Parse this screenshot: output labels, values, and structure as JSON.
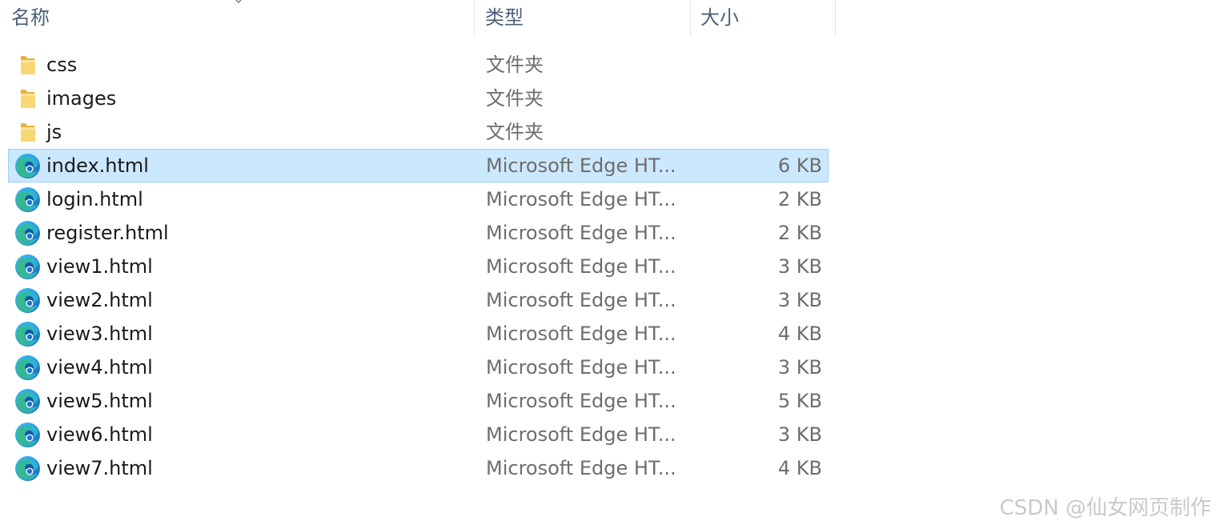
{
  "columns": {
    "name": "名称",
    "type": "类型",
    "size": "大小"
  },
  "files": [
    {
      "name": "css",
      "type": "文件夹",
      "size": "",
      "icon": "folder-icon",
      "selected": false
    },
    {
      "name": "images",
      "type": "文件夹",
      "size": "",
      "icon": "folder-icon",
      "selected": false
    },
    {
      "name": "js",
      "type": "文件夹",
      "size": "",
      "icon": "folder-icon",
      "selected": false
    },
    {
      "name": "index.html",
      "type": "Microsoft Edge HT...",
      "size": "6 KB",
      "icon": "edge-icon",
      "selected": true
    },
    {
      "name": "login.html",
      "type": "Microsoft Edge HT...",
      "size": "2 KB",
      "icon": "edge-icon",
      "selected": false
    },
    {
      "name": "register.html",
      "type": "Microsoft Edge HT...",
      "size": "2 KB",
      "icon": "edge-icon",
      "selected": false
    },
    {
      "name": "view1.html",
      "type": "Microsoft Edge HT...",
      "size": "3 KB",
      "icon": "edge-icon",
      "selected": false
    },
    {
      "name": "view2.html",
      "type": "Microsoft Edge HT...",
      "size": "3 KB",
      "icon": "edge-icon",
      "selected": false
    },
    {
      "name": "view3.html",
      "type": "Microsoft Edge HT...",
      "size": "4 KB",
      "icon": "edge-icon",
      "selected": false
    },
    {
      "name": "view4.html",
      "type": "Microsoft Edge HT...",
      "size": "3 KB",
      "icon": "edge-icon",
      "selected": false
    },
    {
      "name": "view5.html",
      "type": "Microsoft Edge HT...",
      "size": "5 KB",
      "icon": "edge-icon",
      "selected": false
    },
    {
      "name": "view6.html",
      "type": "Microsoft Edge HT...",
      "size": "3 KB",
      "icon": "edge-icon",
      "selected": false
    },
    {
      "name": "view7.html",
      "type": "Microsoft Edge HT...",
      "size": "4 KB",
      "icon": "edge-icon",
      "selected": false
    }
  ],
  "watermark": "CSDN @仙女网页制作",
  "colors": {
    "selection_bg": "#cce8ff",
    "selection_border": "#99d1ff",
    "header_text": "#4c607a",
    "folder_yellow": "#f8d775",
    "edge_blue": "#0c59a4",
    "edge_green": "#3bbd6a"
  }
}
